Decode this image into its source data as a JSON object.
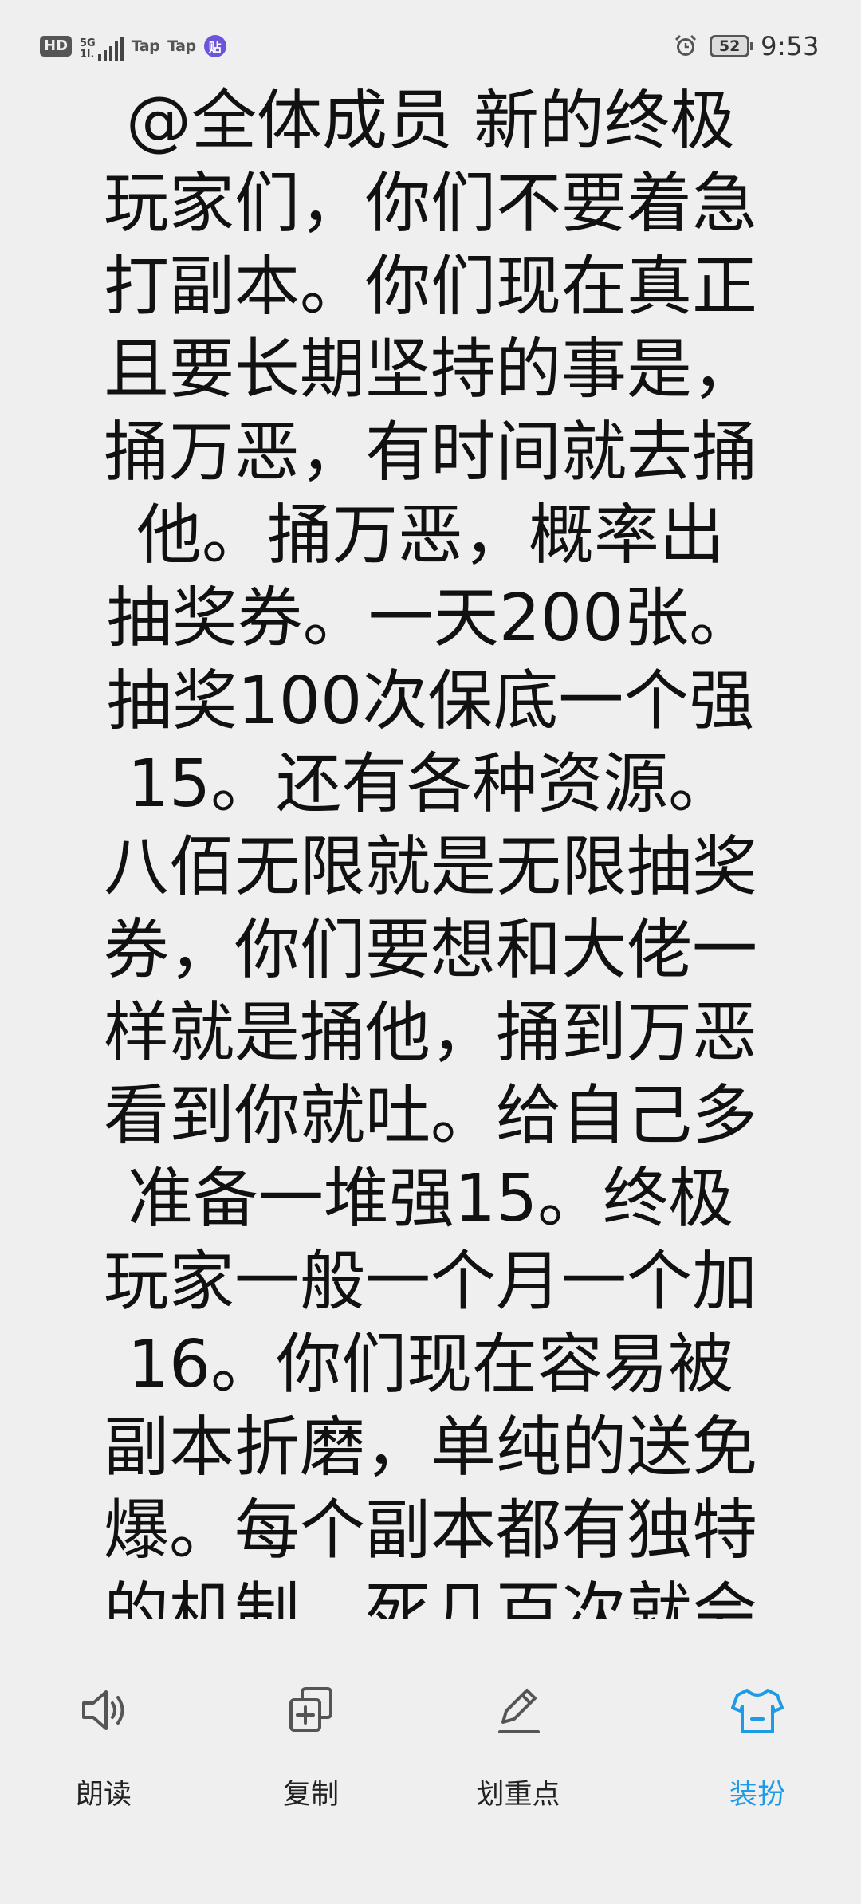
{
  "status_bar": {
    "hd": "HD",
    "network_type": "5G",
    "network_speed": "1l.",
    "app_notif_1": "Tap",
    "app_notif_2": "Tap",
    "app_badge": "贴",
    "battery_level": "52",
    "time": "9:53",
    "icons": [
      "signal-icon",
      "alarm-icon",
      "battery-icon"
    ]
  },
  "message": {
    "lines": [
      "@全体成员 新的终极",
      "玩家们，你们不要着急",
      "打副本。你们现在真正",
      "且要长期坚持的事是，",
      "捅万恶，有时间就去捅",
      "他。捅万恶，概率出",
      "抽奖券。一天200张。",
      "抽奖100次保底一个强",
      "15。还有各种资源。",
      "八佰无限就是无限抽奖",
      "券，你们要想和大佬一",
      "样就是捅他，捅到万恶",
      "看到你就吐。给自己多",
      "准备一堆强15。终极",
      "玩家一般一个月一个加",
      "16。你们现在容易被",
      "副本折磨，单纯的送免",
      "爆。每个副本都有独特",
      "的机制。死几百次就会"
    ]
  },
  "toolbar": {
    "read_label": "朗读",
    "copy_label": "复制",
    "highlight_label": "划重点",
    "theme_label": "装扮",
    "accent_color": "#1e9be8"
  }
}
